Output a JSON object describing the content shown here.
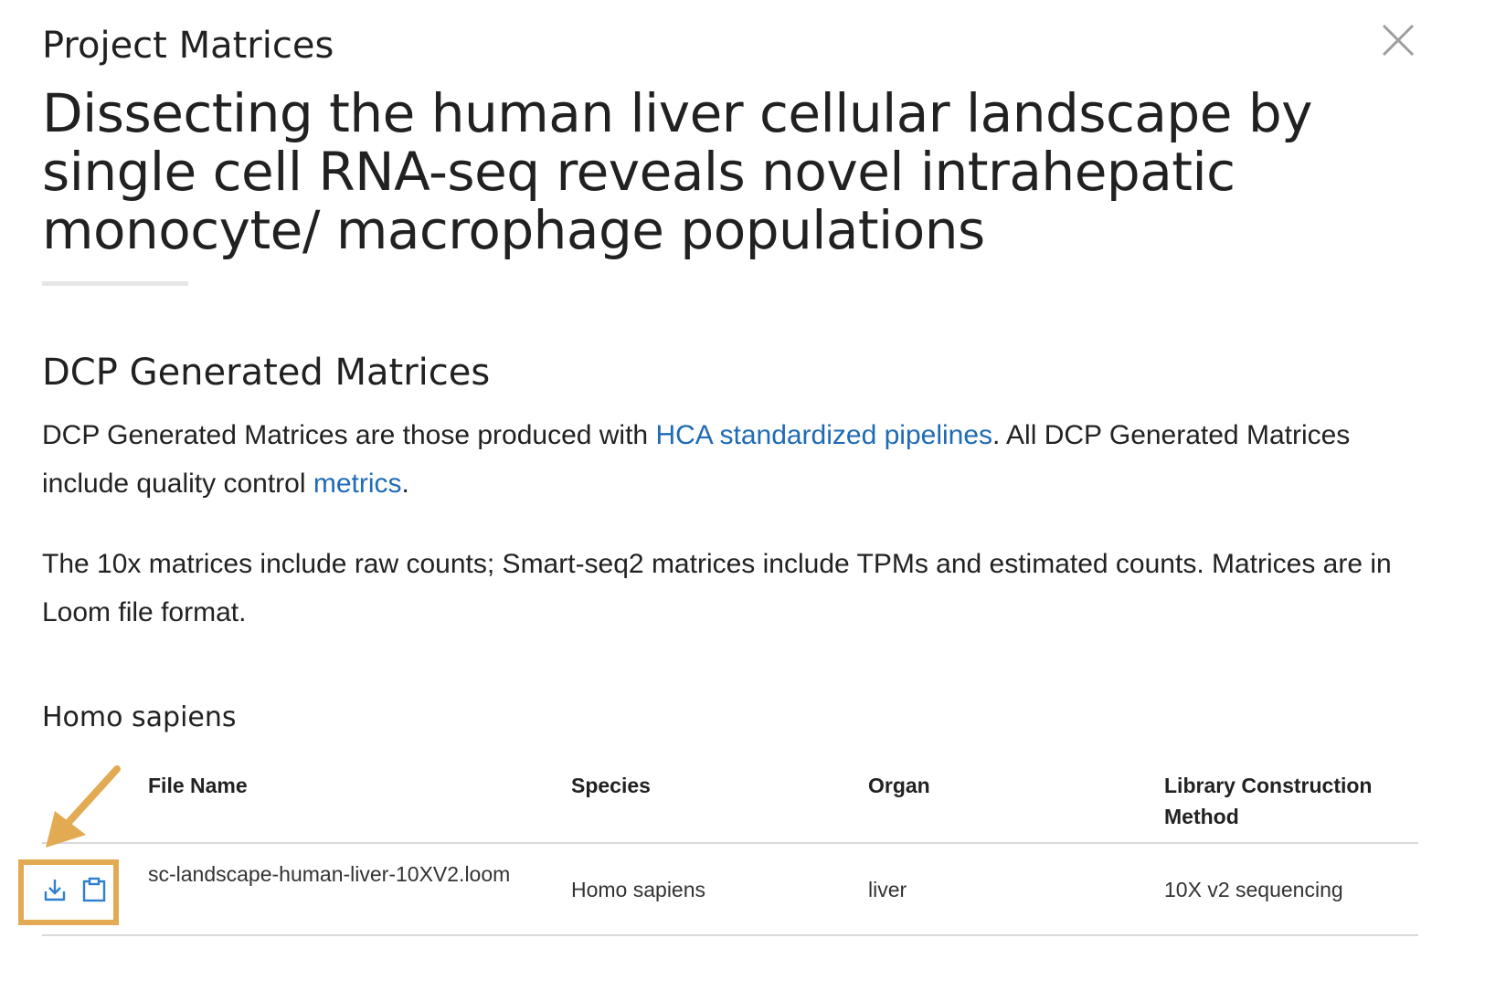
{
  "header": {
    "kicker": "Project Matrices",
    "title": "Dissecting the human liver cellular landscape by single cell RNA-seq reveals novel intrahepatic monocyte/ macrophage populations"
  },
  "section": {
    "heading": "DCP Generated Matrices",
    "p1_before": "DCP Generated Matrices are those produced with ",
    "p1_link1": "HCA standardized pipelines",
    "p1_middle": ". All DCP Generated Matrices include quality control ",
    "p1_link2": "metrics",
    "p1_after": ".",
    "p2": "The 10x matrices include raw counts; Smart-seq2 matrices include TPMs and estimated counts. Matrices are in Loom file format."
  },
  "species_group": "Homo sapiens",
  "table": {
    "headers": [
      "File Name",
      "Species",
      "Organ",
      "Library Construction Method"
    ],
    "rows": [
      {
        "file_name": "sc-landscape-human-liver-10XV2.loom",
        "species": "Homo sapiens",
        "organ": "liver",
        "method": "10X v2 sequencing"
      }
    ]
  },
  "icons": {
    "close": "close-icon",
    "download": "download-icon",
    "copy": "clipboard-icon",
    "annotation": "arrow-annotation"
  },
  "colors": {
    "link": "#1f6bb5",
    "highlight": "#e2aa52"
  }
}
